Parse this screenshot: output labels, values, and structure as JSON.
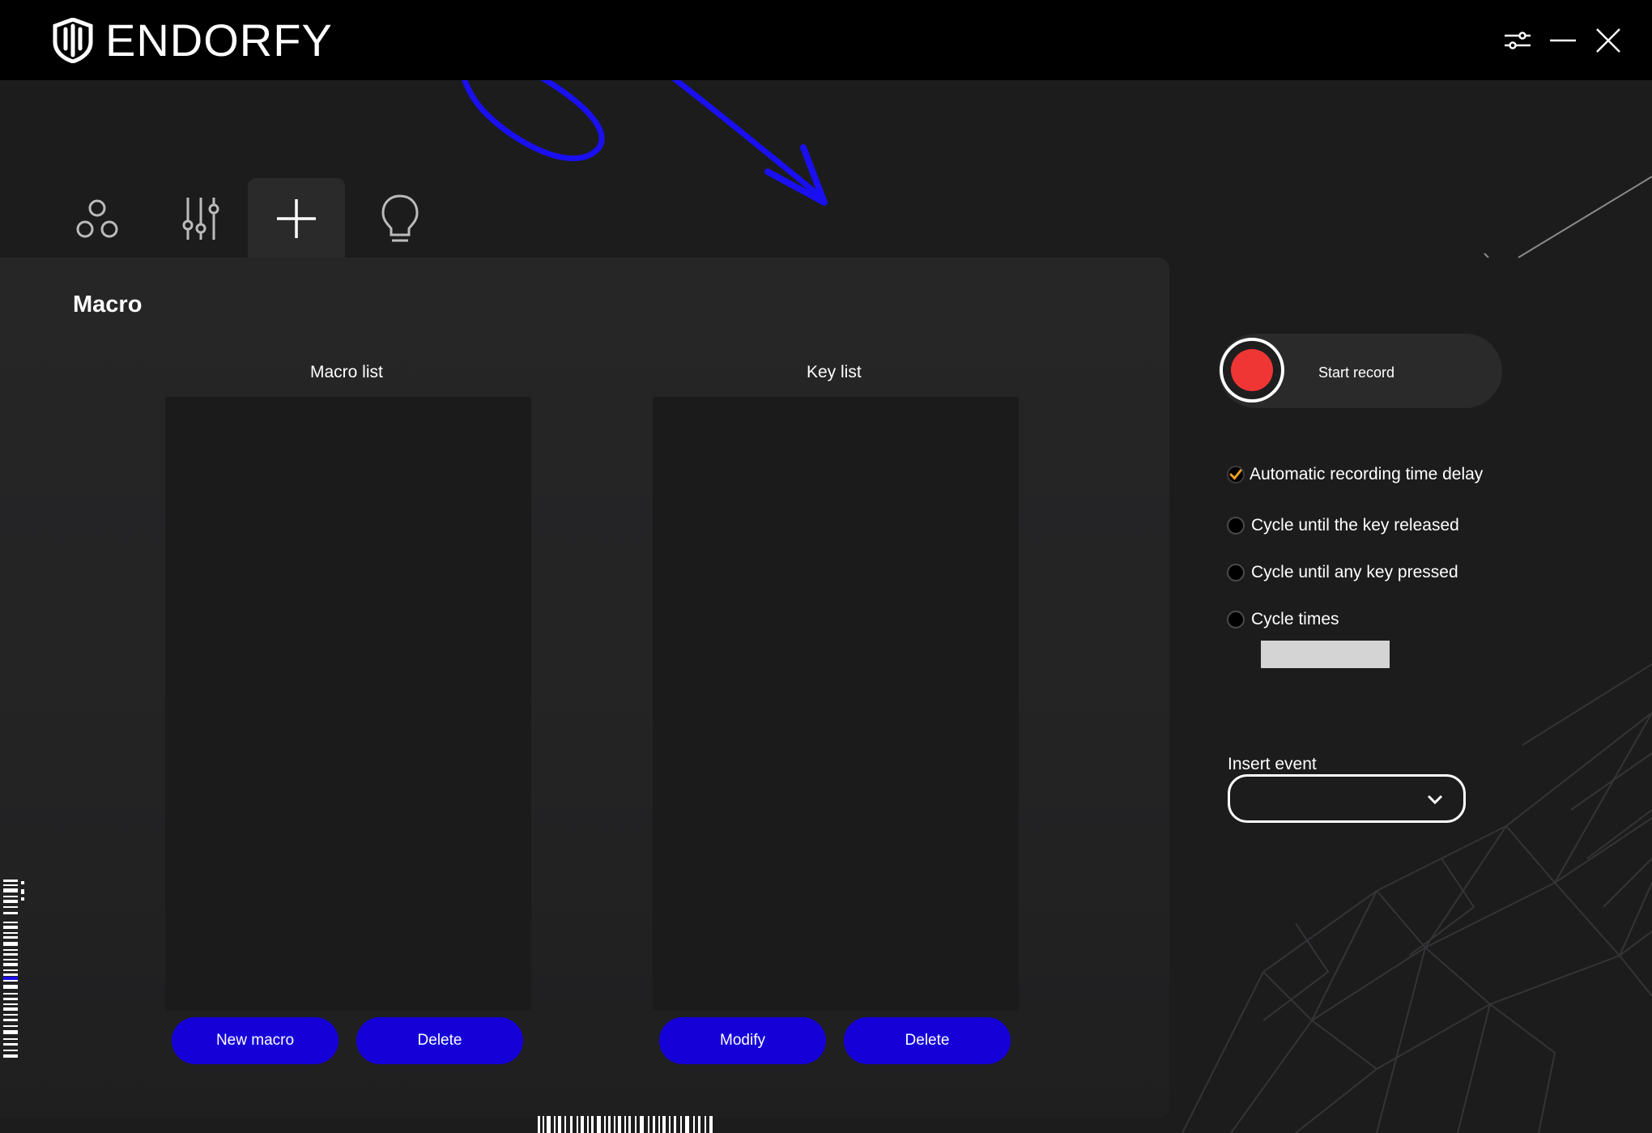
{
  "app": {
    "brand": "ENDORFY"
  },
  "window_controls": [
    {
      "name": "settings",
      "icon": "sliders-icon"
    },
    {
      "name": "minimize",
      "icon": "minimize-icon"
    },
    {
      "name": "close",
      "icon": "close-icon"
    }
  ],
  "tabs": [
    {
      "icon": "circles-icon",
      "active": false
    },
    {
      "icon": "sliders-vertical-icon",
      "active": false
    },
    {
      "icon": "plus-icon",
      "active": true
    },
    {
      "icon": "lightbulb-icon",
      "active": false
    }
  ],
  "section": {
    "title": "Macro"
  },
  "macro_list": {
    "label": "Macro list",
    "items": [],
    "new_button": "New macro",
    "delete_button": "Delete"
  },
  "key_list": {
    "label": "Key list",
    "items": [],
    "modify_button": "Modify",
    "delete_button": "Delete"
  },
  "record": {
    "label": "Start record",
    "dot_color": "#f03535"
  },
  "options": {
    "auto_delay": {
      "label": "Automatic recording time delay",
      "checked": true
    },
    "cycle_released": {
      "label": "Cycle until the key released",
      "selected": false
    },
    "cycle_any_key": {
      "label": "Cycle until any key pressed",
      "selected": false
    },
    "cycle_times": {
      "label": "Cycle times",
      "selected": false,
      "value": ""
    }
  },
  "insert_event": {
    "label": "Insert event",
    "selected": ""
  },
  "colors": {
    "accent": "#1500d8",
    "check": "#f0a020",
    "background": "#1c1c1d",
    "titlebar": "#000000"
  }
}
